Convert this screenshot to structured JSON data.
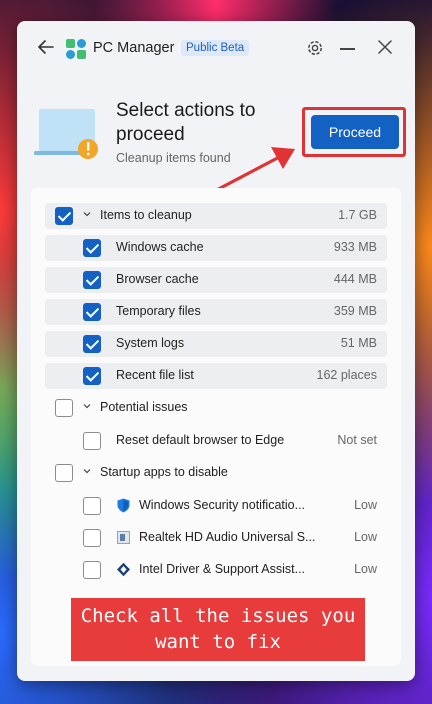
{
  "app": {
    "title": "PC Manager",
    "badge": "Public Beta",
    "icons": {
      "back": "back-arrow-icon",
      "logo": "pc-manager-logo",
      "settings": "gear-icon",
      "minimize": "minimize-icon",
      "close": "close-icon"
    }
  },
  "header": {
    "title": "Select actions to proceed",
    "subtitle": "Cleanup items found",
    "proceed_label": "Proceed",
    "illustration": "laptop-warning-icon"
  },
  "sections": [
    {
      "label": "Items to cleanup",
      "value": "1.7 GB",
      "checked": true,
      "items": [
        {
          "label": "Windows cache",
          "value": "933 MB",
          "checked": true
        },
        {
          "label": "Browser cache",
          "value": "444 MB",
          "checked": true
        },
        {
          "label": "Temporary files",
          "value": "359 MB",
          "checked": true
        },
        {
          "label": "System logs",
          "value": "51 MB",
          "checked": true
        },
        {
          "label": "Recent file list",
          "value": "162 places",
          "checked": true
        }
      ]
    },
    {
      "label": "Potential issues",
      "value": "",
      "checked": false,
      "items": [
        {
          "label": "Reset default browser to Edge",
          "value": "Not set",
          "checked": false
        }
      ]
    },
    {
      "label": "Startup apps to disable",
      "value": "",
      "checked": false,
      "items": [
        {
          "label": "Windows Security notificatio...",
          "value": "Low",
          "checked": false,
          "icon": "windows-security-shield-icon"
        },
        {
          "label": "Realtek HD Audio Universal S...",
          "value": "Low",
          "checked": false,
          "icon": "realtek-audio-icon"
        },
        {
          "label": "Intel Driver & Support Assist...",
          "value": "Low",
          "checked": false,
          "icon": "intel-driver-icon"
        }
      ]
    }
  ],
  "annotation": {
    "line1": "Check all the issues you",
    "line2": "want to fix"
  },
  "colors": {
    "accent": "#1461c4",
    "highlight": "#e03434",
    "callout": "#e83b3b"
  }
}
